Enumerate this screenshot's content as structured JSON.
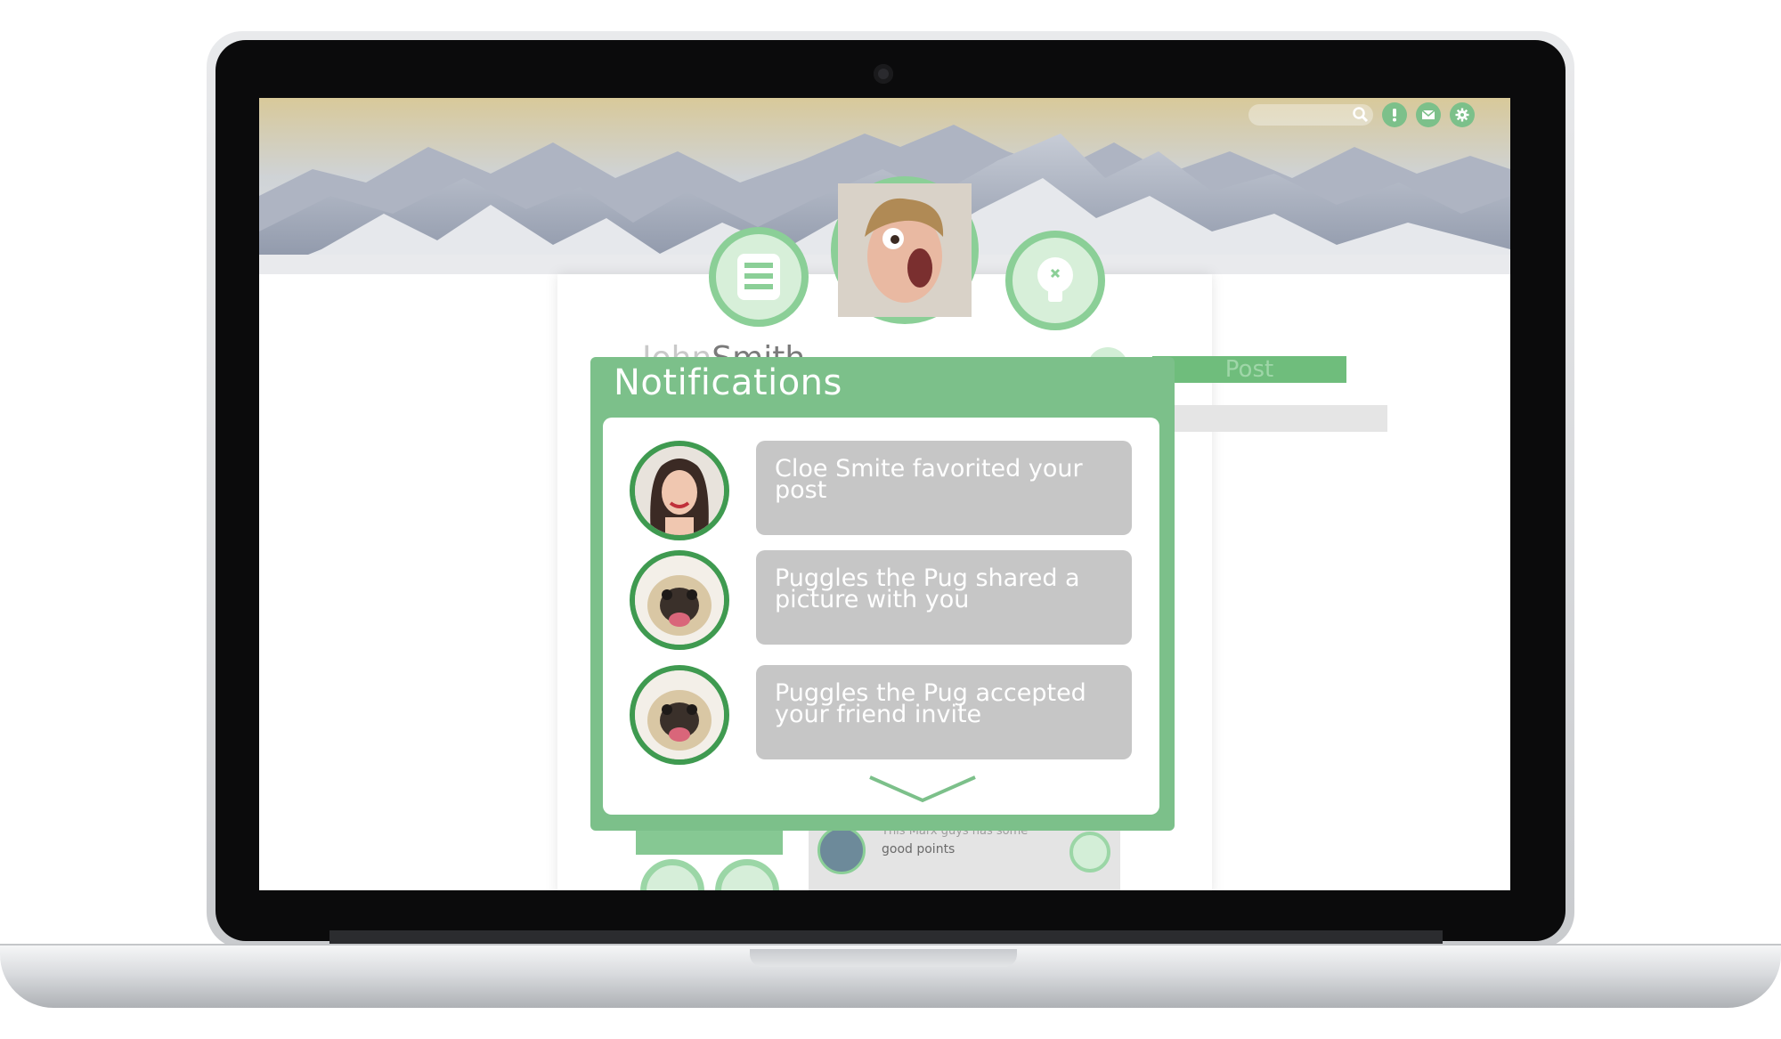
{
  "screen": {
    "header": {
      "search_placeholder": "",
      "icons": [
        "search-icon",
        "alert-icon",
        "mail-icon",
        "gear-icon"
      ],
      "accent": "#7cc08a"
    },
    "profile": {
      "first_name": "John",
      "last_name": "Smith",
      "post_button": "Post",
      "avatar": "user-avatar",
      "left_button_icon": "list-icon",
      "right_button_icon": "lightbulb-icon"
    },
    "notifications": {
      "title": "Notifications",
      "items": [
        {
          "text": "Cloe Smite favorited your post",
          "avatar": "woman-avatar"
        },
        {
          "text": "Puggles the Pug shared a picture with you",
          "avatar": "pug-avatar"
        },
        {
          "text": "Puggles the Pug accepted your friend invite",
          "avatar": "pug-avatar"
        }
      ],
      "more_icon": "chevron-down-icon"
    },
    "comment": {
      "line1": "This Marx guys has some",
      "line2": "good points"
    }
  }
}
